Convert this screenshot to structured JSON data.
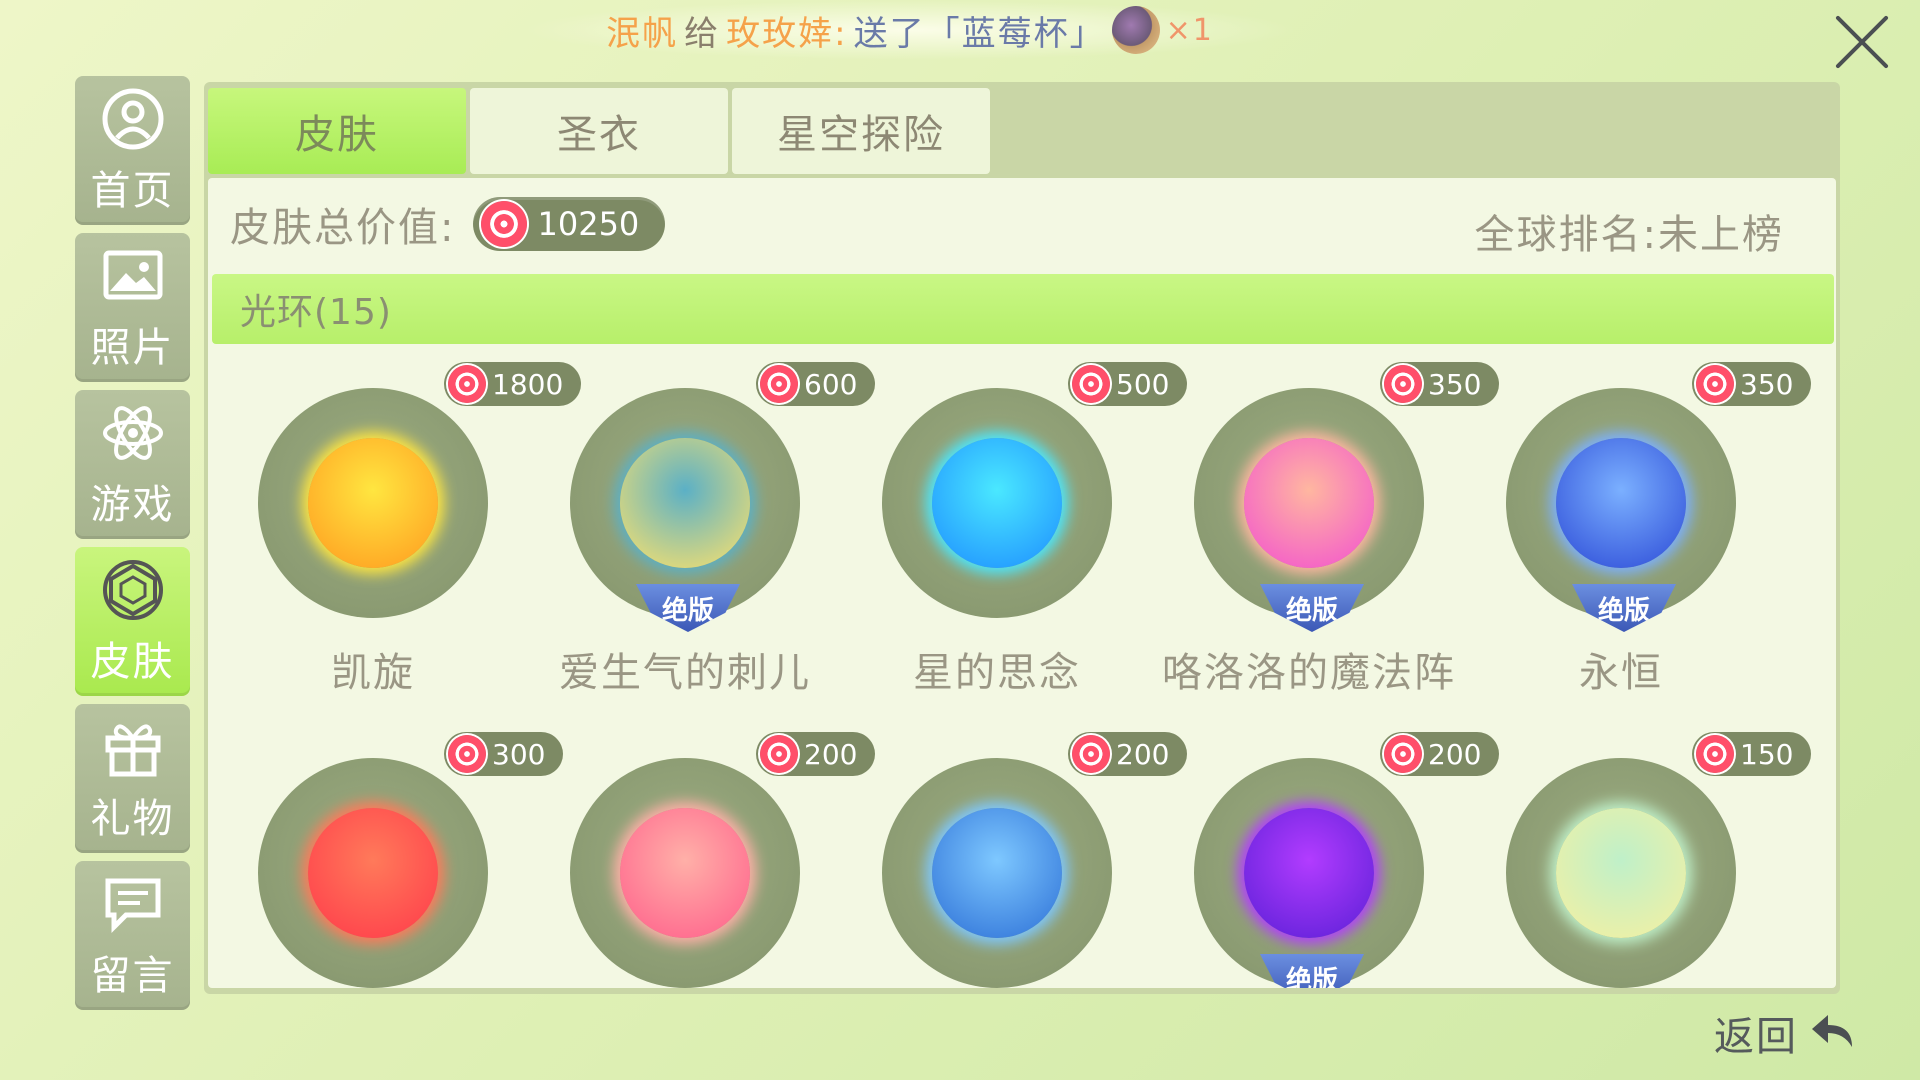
{
  "notice": {
    "sender": "泯帆",
    "verb": "给",
    "receiver": "玫玫婞:",
    "action": "送了「蓝莓杯」",
    "count": "×1",
    "gift_icon": "blueberry-cup-icon"
  },
  "sidebar": {
    "items": [
      {
        "label": "首页",
        "icon": "user-icon",
        "active": false
      },
      {
        "label": "照片",
        "icon": "photo-icon",
        "active": false
      },
      {
        "label": "游戏",
        "icon": "atom-icon",
        "active": false
      },
      {
        "label": "皮肤",
        "icon": "gem-icon",
        "active": true
      },
      {
        "label": "礼物",
        "icon": "gift-icon",
        "active": false
      },
      {
        "label": "留言",
        "icon": "message-icon",
        "active": false
      }
    ]
  },
  "tabs": [
    {
      "label": "皮肤",
      "active": true
    },
    {
      "label": "圣衣",
      "active": false
    },
    {
      "label": "星空探险",
      "active": false
    }
  ],
  "summary": {
    "total_label": "皮肤总价值:",
    "total_value": "10250",
    "rank_text": "全球排名:未上榜"
  },
  "section": {
    "title": "光环(15)"
  },
  "items": [
    {
      "name": "凯旋",
      "price": "1800",
      "limited": false,
      "colors": [
        "#ffe640",
        "#ff9a1f"
      ]
    },
    {
      "name": "爱生气的刺儿",
      "price": "600",
      "limited": true,
      "colors": [
        "#5bb0c6",
        "#ffe36a"
      ]
    },
    {
      "name": "星的思念",
      "price": "500",
      "limited": false,
      "colors": [
        "#4ae8ff",
        "#1d8dff"
      ]
    },
    {
      "name": "咯洛洛的魔法阵",
      "price": "350",
      "limited": true,
      "colors": [
        "#ffb7a0",
        "#f24fd0"
      ]
    },
    {
      "name": "永恒",
      "price": "350",
      "limited": true,
      "colors": [
        "#7bb0ff",
        "#2b49d6"
      ]
    },
    {
      "name": "",
      "price": "300",
      "limited": false,
      "colors": [
        "#ff7a5a",
        "#ff3a4a"
      ]
    },
    {
      "name": "",
      "price": "200",
      "limited": false,
      "colors": [
        "#ffb0a8",
        "#ff5d8a"
      ]
    },
    {
      "name": "",
      "price": "200",
      "limited": false,
      "colors": [
        "#7ec8ff",
        "#2c6fd6"
      ]
    },
    {
      "name": "",
      "price": "200",
      "limited": true,
      "colors": [
        "#b23cff",
        "#5a1fd6"
      ]
    },
    {
      "name": "",
      "price": "150",
      "limited": false,
      "colors": [
        "#bff0c9",
        "#f6f0a0"
      ]
    }
  ],
  "badge_label": "绝版",
  "back": {
    "label": "返回",
    "icon": "back-arrow-icon"
  },
  "close": {
    "icon": "close-icon"
  }
}
